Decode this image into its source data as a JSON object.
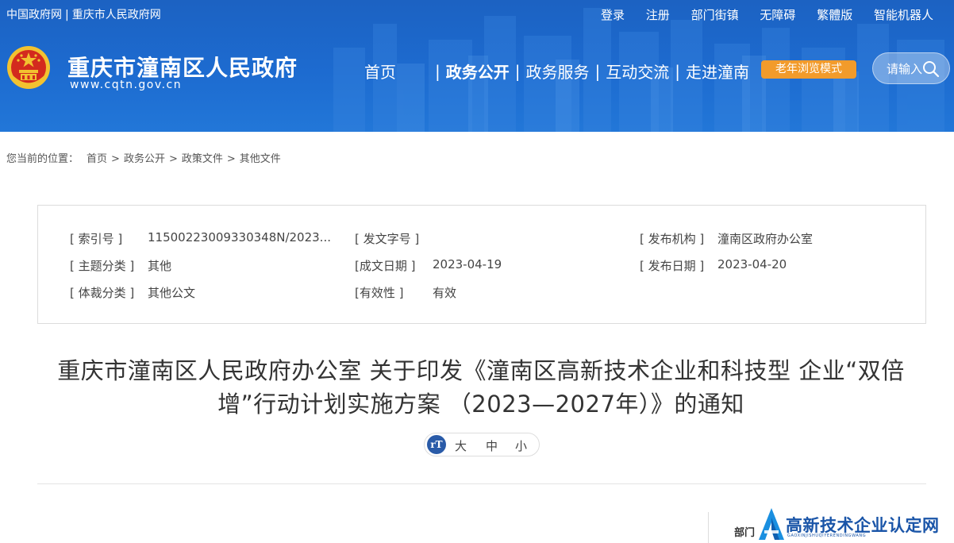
{
  "topbar": {
    "left_links": [
      "中国政府网",
      "重庆市人民政府网"
    ],
    "separator": "|",
    "right_links": [
      "登录",
      "注册",
      "部门街镇",
      "无障碍",
      "繁體版",
      "智能机器人"
    ]
  },
  "site": {
    "title": "重庆市潼南区人民政府",
    "url": "www.cqtn.gov.cn"
  },
  "nav": {
    "items": [
      "首页",
      "政务公开",
      "政务服务",
      "互动交流",
      "走进潼南"
    ],
    "active": "政务公开",
    "divider": "|",
    "elder_mode": "老年浏览模式"
  },
  "search": {
    "placeholder": "请输入"
  },
  "breadcrumb": {
    "label": "您当前的位置：",
    "items": [
      "首页",
      "政务公开",
      "政策文件",
      "其他文件"
    ],
    "arrow": ">"
  },
  "meta": {
    "index_key": "[ 索引号 ]",
    "index_val": "11500223009330348N/2023...",
    "doc_no_key": "[ 发文字号 ]",
    "doc_no_val": "",
    "issuer_key": "[ 发布机构 ]",
    "issuer_val": "潼南区政府办公室",
    "topic_key": "[ 主题分类 ]",
    "topic_val": "其他",
    "written_key": "[成文日期 ]",
    "written_val": "2023-04-19",
    "publish_key": "[ 发布日期 ]",
    "publish_val": "2023-04-20",
    "genre_key": "[ 体裁分类 ]",
    "genre_val": "其他公文",
    "validity_key": "[有效性 ]",
    "validity_val": "有效"
  },
  "article": {
    "title": "重庆市潼南区人民政府办公室 关于印发《潼南区高新技术企业和科技型 企业“双倍增”行动计划实施方案 （2023—2027年）》的通知"
  },
  "font_size": {
    "icon_text": "rT",
    "options": [
      "大",
      "中",
      "小"
    ]
  },
  "sidebar": {
    "dept_label": "部门"
  },
  "watermark": {
    "text": "高新技术企业认定网",
    "sub": "GAOXINJISHUQIYERENDINGWANG"
  },
  "colors": {
    "header_blue": "#1d6bd0",
    "elder_orange": "#f29b2b",
    "watermark_blue": "#1a55a8"
  }
}
